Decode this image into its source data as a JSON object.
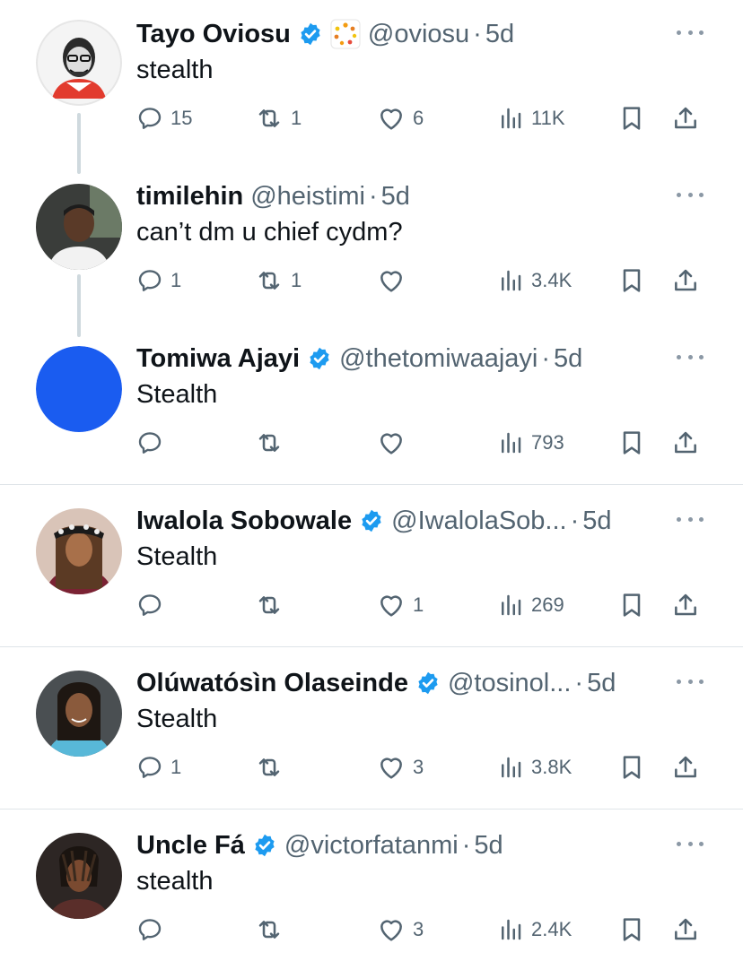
{
  "tweets": [
    {
      "name": "Tayo Oviosu",
      "verified": true,
      "affiliate_badge": true,
      "handle": "@oviosu",
      "separator": "·",
      "time": "5d",
      "text": "stealth",
      "replies": "15",
      "retweets": "1",
      "likes": "6",
      "views": "11K"
    },
    {
      "name": "timilehin",
      "verified": false,
      "handle": "@heistimi",
      "separator": "·",
      "time": "5d",
      "text": "can’t dm u chief cydm?",
      "replies": "1",
      "retweets": "1",
      "likes": "",
      "views": "3.4K"
    },
    {
      "name": "Tomiwa Ajayi",
      "verified": true,
      "handle": "@thetomiwaajayi",
      "separator": "·",
      "time": "5d",
      "text": "Stealth",
      "replies": "",
      "retweets": "",
      "likes": "",
      "views": "793"
    },
    {
      "name": "Iwalola Sobowale",
      "verified": true,
      "handle": "@IwalolaSob...",
      "separator": "·",
      "time": "5d",
      "text": "Stealth",
      "replies": "",
      "retweets": "",
      "likes": "1",
      "views": "269"
    },
    {
      "name": "Olúwatósìn Olaseinde",
      "verified": true,
      "handle": "@tosinol...",
      "separator": "·",
      "time": "5d",
      "text": "Stealth",
      "replies": "1",
      "retweets": "",
      "likes": "3",
      "views": "3.8K"
    },
    {
      "name": "Uncle Fá",
      "verified": true,
      "handle": "@victorfatanmi",
      "separator": "·",
      "time": "5d",
      "text": "stealth",
      "replies": "",
      "retweets": "",
      "likes": "3",
      "views": "2.4K"
    }
  ],
  "colors": {
    "verified": "#1d9bf0",
    "muted": "#536471",
    "divider": "#dfe4e8",
    "thread_line": "#cfd9de",
    "avatar_blue": "#1a5cf0"
  },
  "icons": [
    "verified-badge-icon",
    "affiliate-badge-icon",
    "more-icon",
    "reply-icon",
    "retweet-icon",
    "like-icon",
    "views-icon",
    "bookmark-icon",
    "share-icon"
  ]
}
